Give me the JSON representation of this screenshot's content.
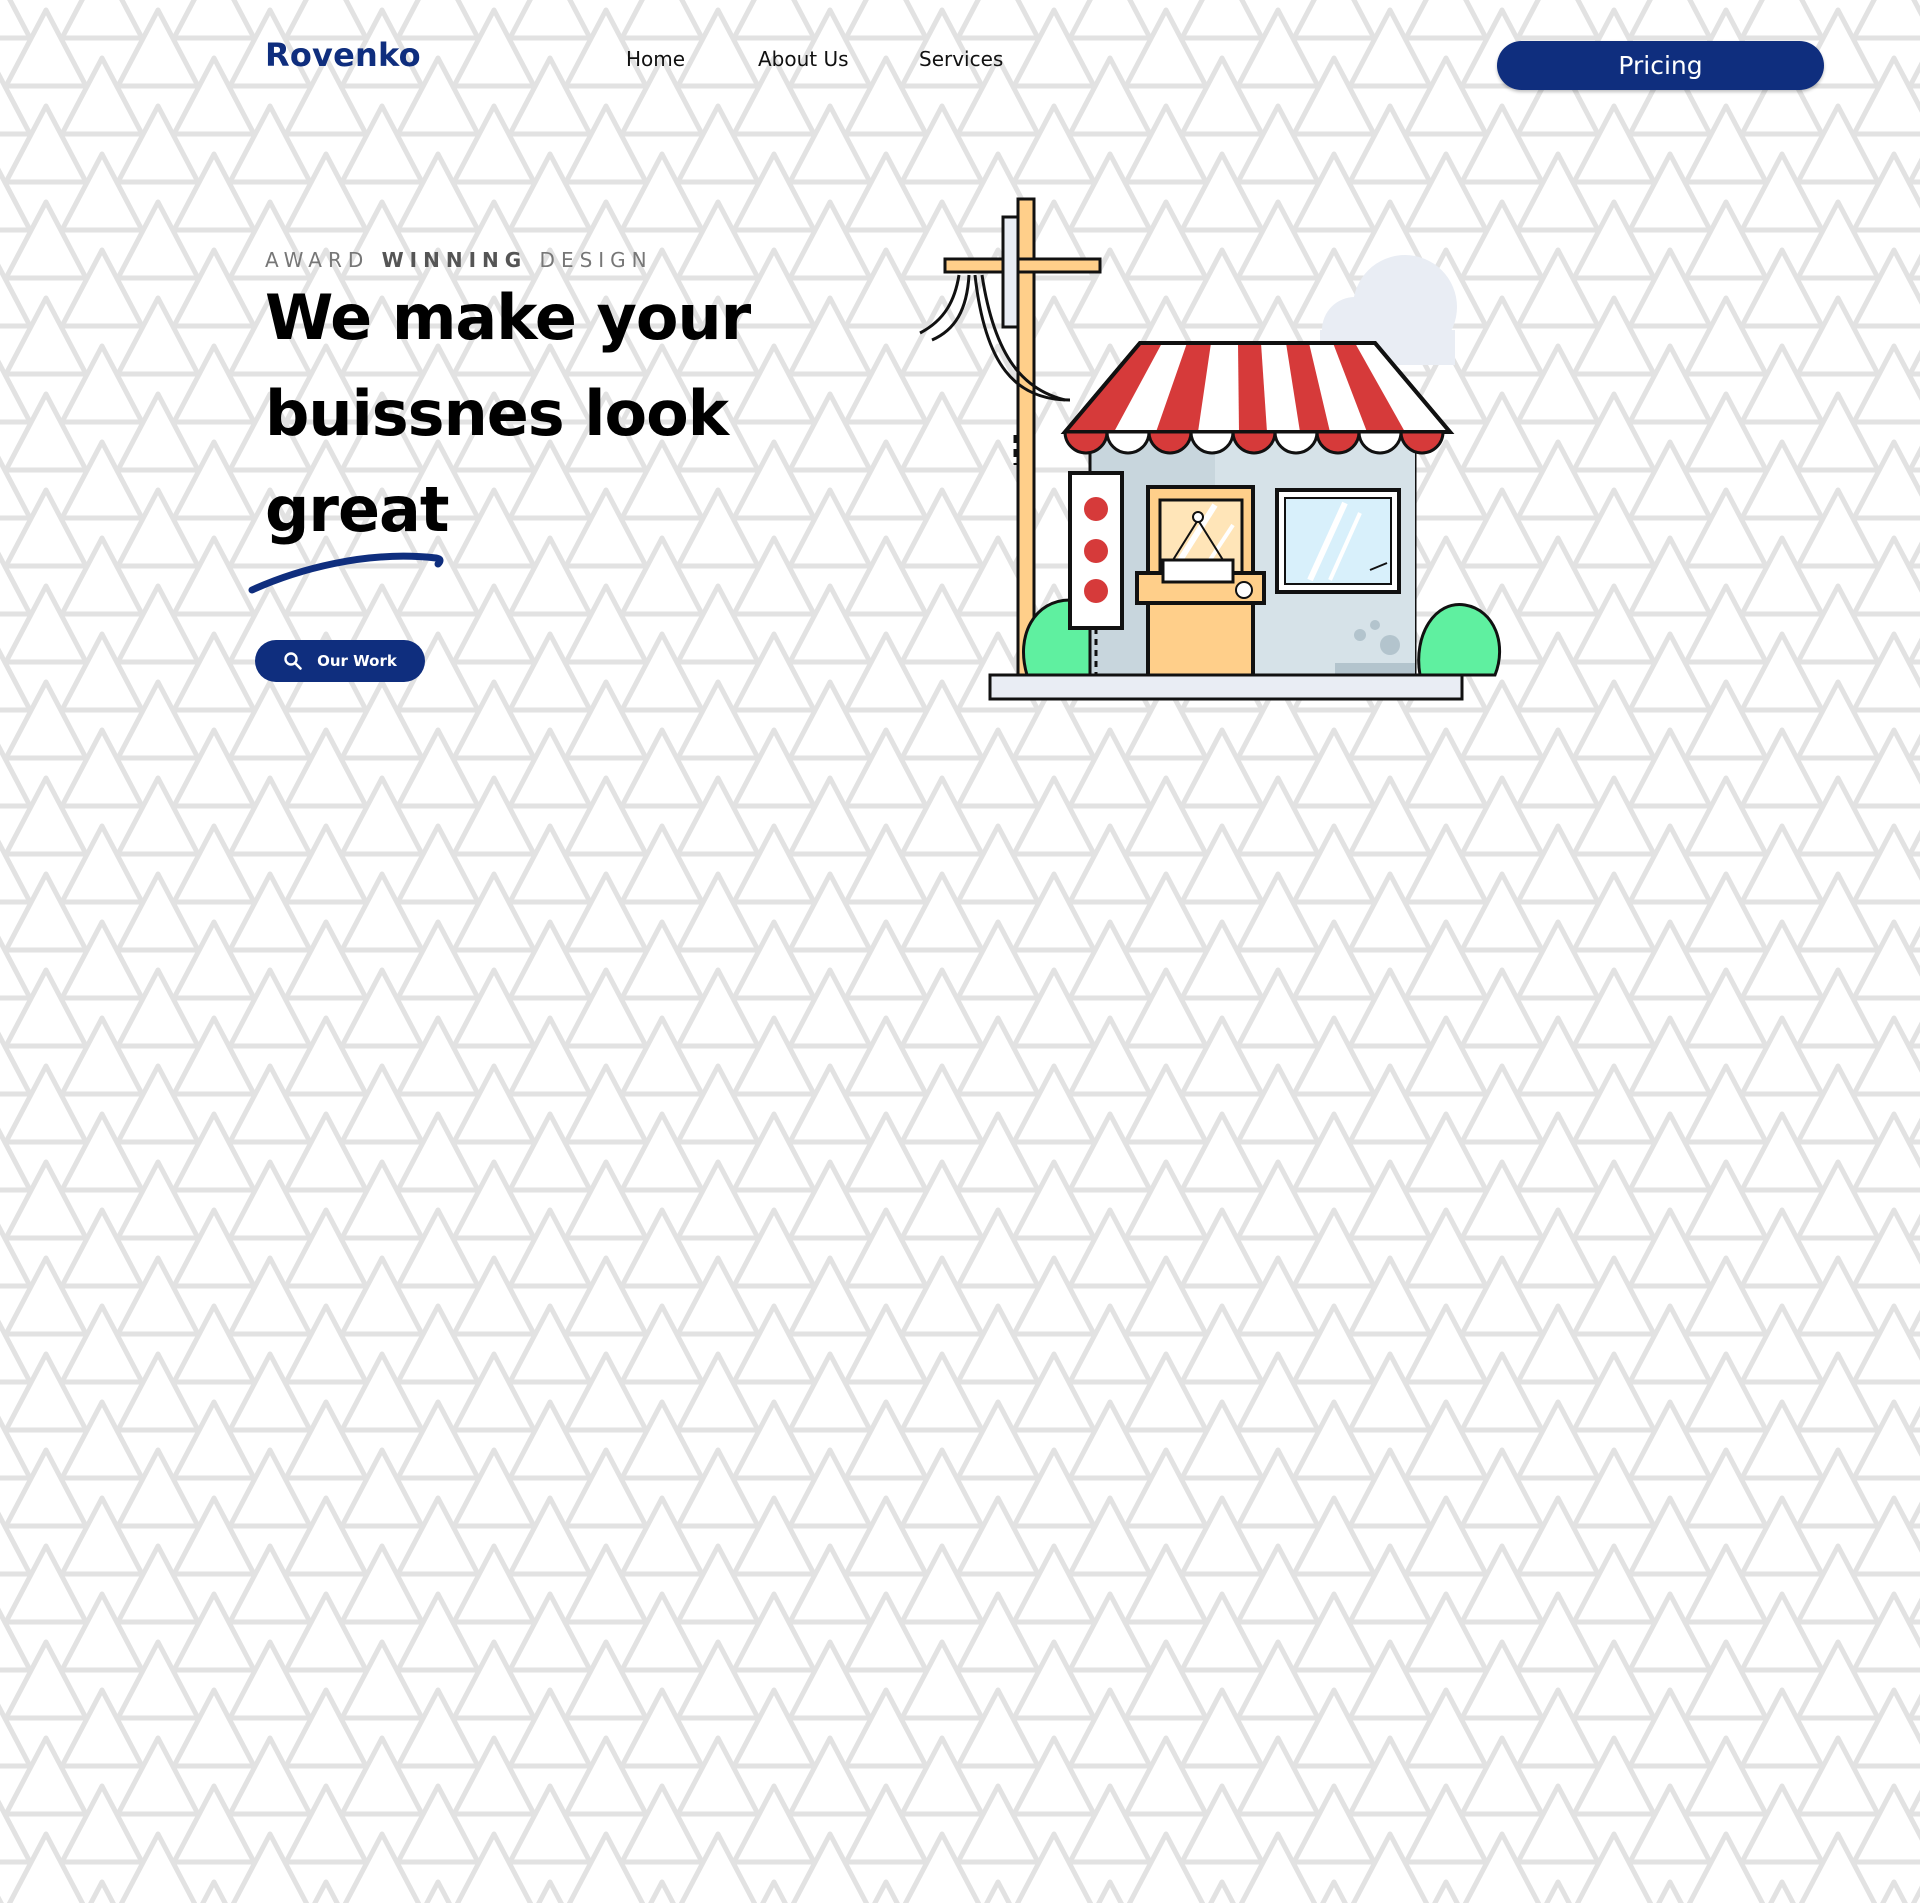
{
  "header": {
    "brand": "Rovenko",
    "nav": [
      {
        "label": "Home"
      },
      {
        "label": "About Us"
      },
      {
        "label": "Services"
      }
    ],
    "pricing_label": "Pricing"
  },
  "hero": {
    "eyebrow_part1": "AWARD",
    "eyebrow_part2": "WINNING",
    "eyebrow_part3": "DESIGN",
    "headline_lines": [
      "We make your",
      "buissnes look",
      "great"
    ],
    "cta_label": "Our Work",
    "cta_icon": "search-icon",
    "illustration": "storefront-illustration"
  },
  "colors": {
    "brand": "#0f2e7e",
    "awning_red": "#d63a3a",
    "bush_green": "#5ff0a0",
    "wood_orange": "#ffcf8a"
  }
}
